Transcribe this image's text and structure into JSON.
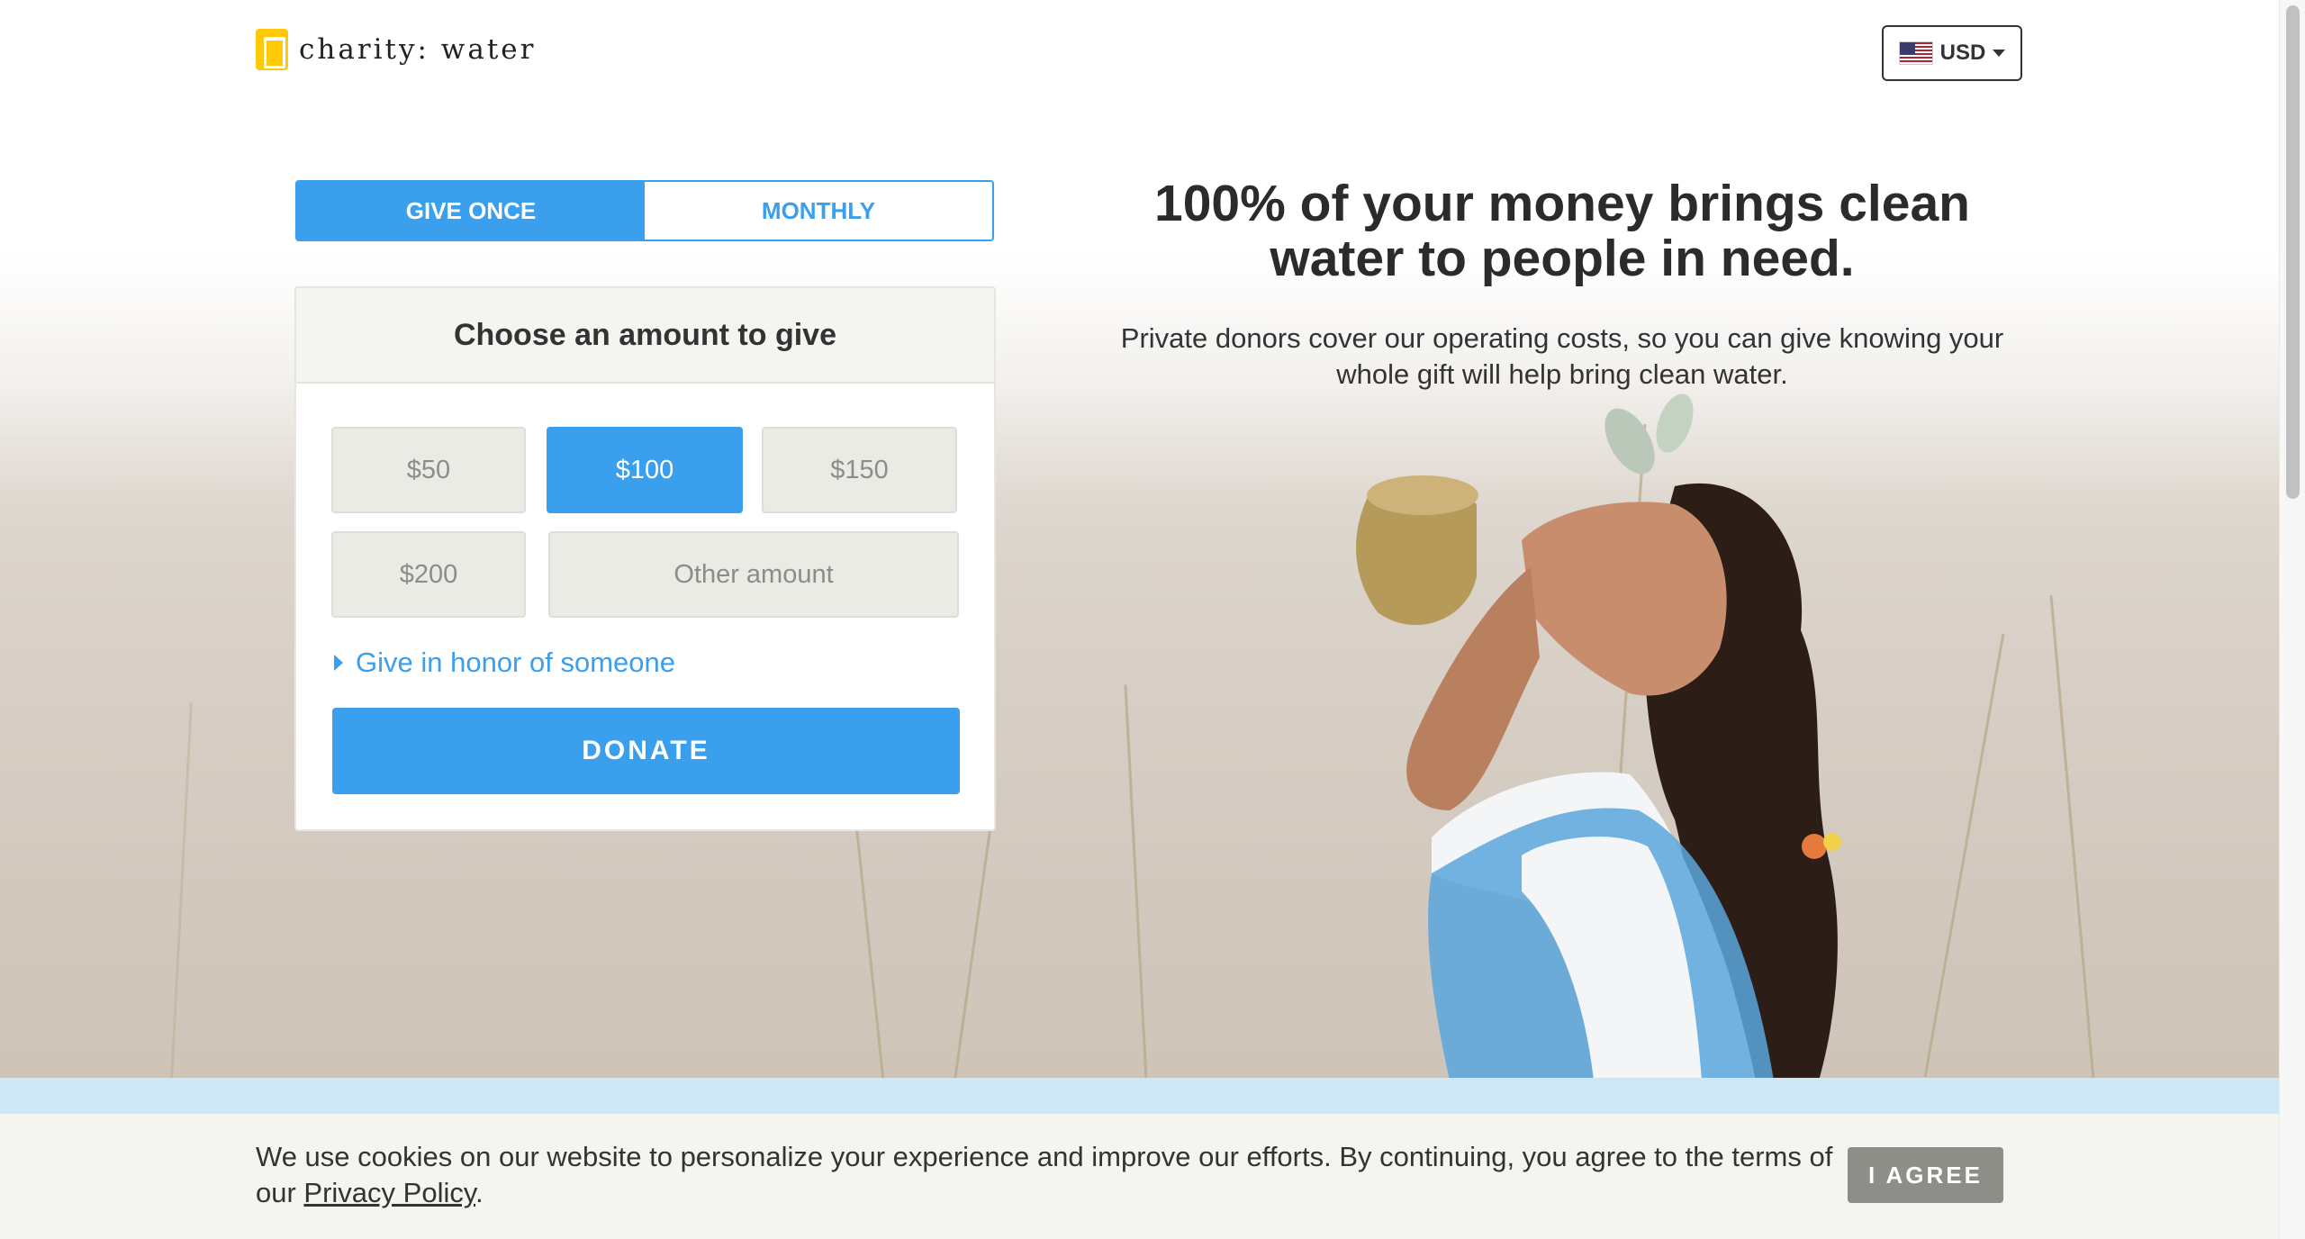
{
  "header": {
    "logo_text": "charity: water",
    "currency": {
      "label": "USD",
      "flag_icon": "us-flag-icon"
    }
  },
  "frequency": {
    "tabs": [
      {
        "label": "GIVE ONCE",
        "active": true
      },
      {
        "label": "MONTHLY",
        "active": false
      }
    ]
  },
  "donation": {
    "title": "Choose an amount to give",
    "amounts": [
      "$50",
      "$100",
      "$150",
      "$200"
    ],
    "selected_amount": "$100",
    "other_placeholder": "Other amount",
    "honor_label": "Give in honor of someone",
    "donate_label": "DONATE"
  },
  "hero": {
    "headline": "100% of your money brings clean water to people in need.",
    "subline": "Private donors cover our operating costs, so you can give knowing your whole gift will help bring clean water."
  },
  "cookie": {
    "text_before": "We use cookies on our website to personalize your experience and improve our efforts. By continuing, you agree to the terms of our ",
    "link": "Privacy Policy",
    "text_after": ".",
    "agree_label": "I AGREE"
  },
  "colors": {
    "accent": "#3a9fec",
    "logo_yellow": "#ffc907",
    "agree_gray": "#8e8e89"
  }
}
